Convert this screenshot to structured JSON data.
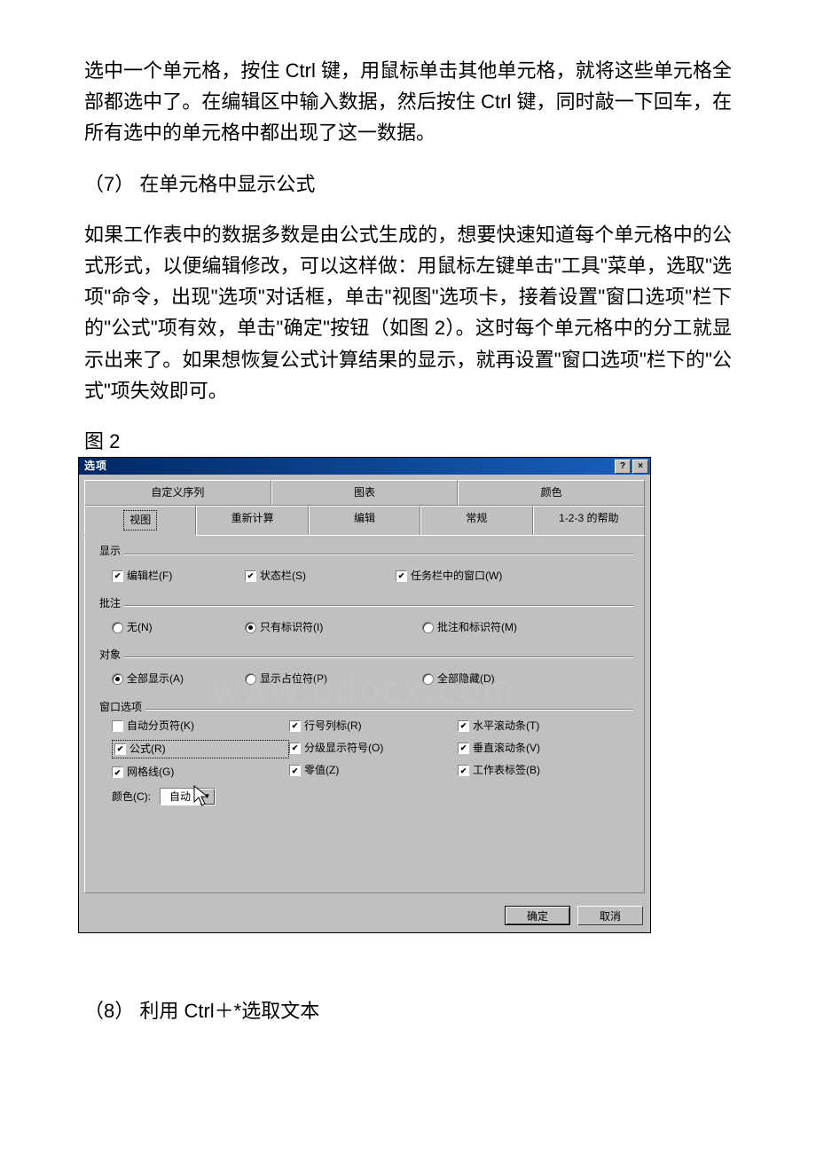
{
  "para1": "选中一个单元格，按住 Ctrl 键，用鼠标单击其他单元格，就将这些单元格全部都选中了。在编辑区中输入数据，然后按住 Ctrl 键，同时敲一下回车，在所有选中的单元格中都出现了这一数据。",
  "heading7": "（7） 在单元格中显示公式",
  "para2": "如果工作表中的数据多数是由公式生成的，想要快速知道每个单元格中的公式形式，以便编辑修改，可以这样做：用鼠标左键单击\"工具\"菜单，选取\"选项\"命令，出现\"选项\"对话框，单击\"视图\"选项卡，接着设置\"窗口选项\"栏下的\"公式\"项有效，单击\"确定\"按钮（如图 2）。这时每个单元格中的分工就显示出来了。如果想恢复公式计算结果的显示，就再设置\"窗口选项\"栏下的\"公式\"项失效即可。",
  "figLabel": "图 2",
  "dialog": {
    "title": "选项",
    "tabsBack": [
      "自定义序列",
      "图表",
      "颜色"
    ],
    "tabsFront": [
      "视图",
      "重新计算",
      "编辑",
      "常规",
      "1-2-3 的帮助"
    ],
    "groups": {
      "display": "显示",
      "comment": "批注",
      "object": "对象",
      "window": "窗口选项"
    },
    "display": {
      "formula_bar": "编辑栏(F)",
      "status_bar": "状态栏(S)",
      "window_in_taskbar": "任务栏中的窗口(W)"
    },
    "comment": {
      "none": "无(N)",
      "indicator": "只有标识符(I)",
      "both": "批注和标识符(M)"
    },
    "object": {
      "show_all": "全部显示(A)",
      "placeholders": "显示占位符(P)",
      "hide_all": "全部隐藏(D)"
    },
    "window": {
      "page_breaks": "自动分页符(K)",
      "formulas": "公式(R)",
      "gridlines": "网格线(G)",
      "row_col_headers": "行号列标(R)",
      "outline_symbols": "分级显示符号(O)",
      "zero_values": "零值(Z)",
      "h_scroll": "水平滚动条(T)",
      "v_scroll": "垂直滚动条(V)",
      "sheet_tabs": "工作表标签(B)",
      "color_label": "颜色(C):",
      "color_value": "自动"
    },
    "buttons": {
      "ok": "确定",
      "cancel": "取消"
    }
  },
  "heading8": "（8） 利用 Ctrl＋*选取文本",
  "watermark": "www.bdocx.com"
}
